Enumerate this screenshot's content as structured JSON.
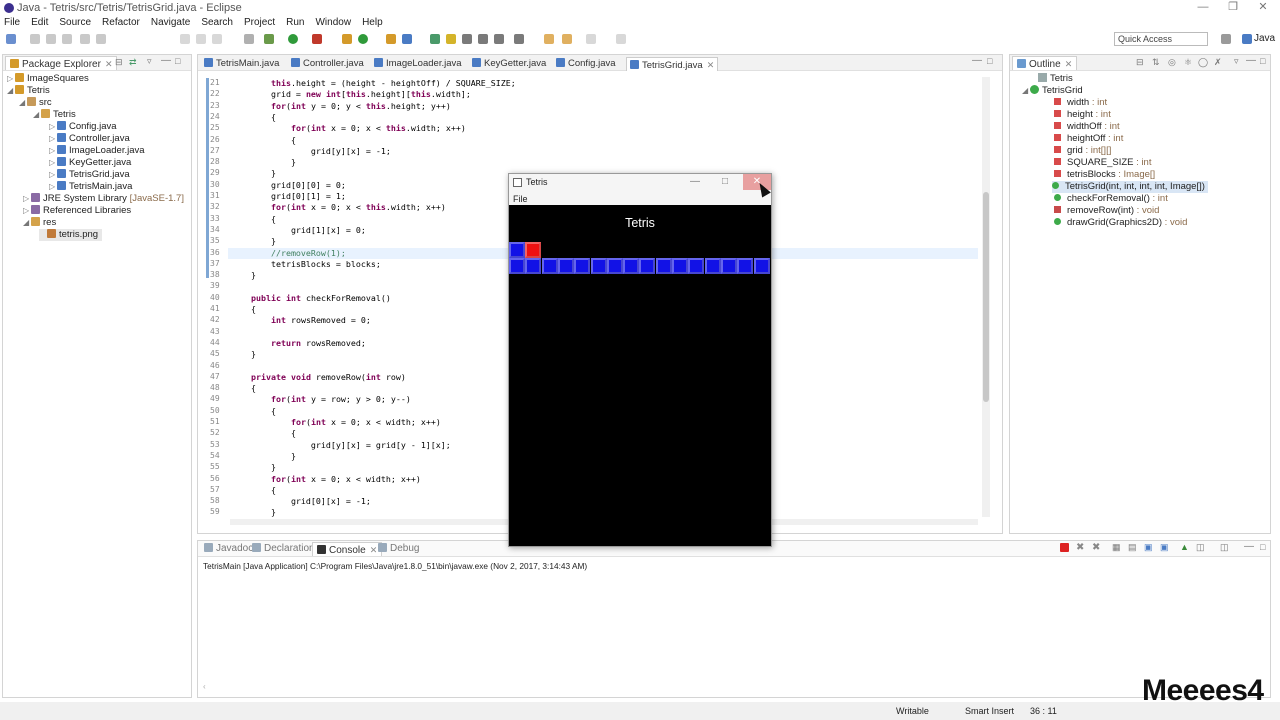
{
  "window": {
    "title": "Java - Tetris/src/Tetris/TetrisGrid.java - Eclipse"
  },
  "menubar": [
    "File",
    "Edit",
    "Source",
    "Refactor",
    "Navigate",
    "Search",
    "Project",
    "Run",
    "Window",
    "Help"
  ],
  "toolbar": {
    "quick_access": "Quick Access",
    "perspective": "Java"
  },
  "package_explorer": {
    "tab": "Package Explorer",
    "items": [
      {
        "label": "ImageSquares"
      },
      {
        "label": "Tetris"
      },
      {
        "label": "src"
      },
      {
        "label": "Tetris"
      },
      {
        "label": "Config.java"
      },
      {
        "label": "Controller.java"
      },
      {
        "label": "ImageLoader.java"
      },
      {
        "label": "KeyGetter.java"
      },
      {
        "label": "TetrisGrid.java"
      },
      {
        "label": "TetrisMain.java"
      },
      {
        "label": "JRE System Library",
        "decoration": "[JavaSE-1.7]"
      },
      {
        "label": "Referenced Libraries"
      },
      {
        "label": "res"
      },
      {
        "label": "tetris.png"
      }
    ]
  },
  "editor": {
    "tabs": [
      "TetrisMain.java",
      "Controller.java",
      "ImageLoader.java",
      "KeyGetter.java",
      "Config.java",
      "TetrisGrid.java"
    ],
    "active_tab": "TetrisGrid.java",
    "lines": [
      {
        "n": "21",
        "text": "        this.height = (height - heightOff) / SQUARE_SIZE;"
      },
      {
        "n": "22",
        "text": "        grid = new int[this.height][this.width];"
      },
      {
        "n": "23",
        "text": "        for(int y = 0; y < this.height; y++)"
      },
      {
        "n": "24",
        "text": "        {"
      },
      {
        "n": "25",
        "text": "            for(int x = 0; x < this.width; x++)"
      },
      {
        "n": "26",
        "text": "            {"
      },
      {
        "n": "27",
        "text": "                grid[y][x] = -1;"
      },
      {
        "n": "28",
        "text": "            }"
      },
      {
        "n": "29",
        "text": "        }"
      },
      {
        "n": "30",
        "text": "        grid[0][0] = 0;"
      },
      {
        "n": "31",
        "text": "        grid[0][1] = 1;"
      },
      {
        "n": "32",
        "text": "        for(int x = 0; x < this.width; x++)"
      },
      {
        "n": "33",
        "text": "        {"
      },
      {
        "n": "34",
        "text": "            grid[1][x] = 0;"
      },
      {
        "n": "35",
        "text": "        }"
      },
      {
        "n": "36",
        "text": "        //removeRow(1);"
      },
      {
        "n": "37",
        "text": "        tetrisBlocks = blocks;"
      },
      {
        "n": "38",
        "text": "    }"
      },
      {
        "n": "39",
        "text": ""
      },
      {
        "n": "40",
        "text": "    public int checkForRemoval()"
      },
      {
        "n": "41",
        "text": "    {"
      },
      {
        "n": "42",
        "text": "        int rowsRemoved = 0;"
      },
      {
        "n": "43",
        "text": ""
      },
      {
        "n": "44",
        "text": "        return rowsRemoved;"
      },
      {
        "n": "45",
        "text": "    }"
      },
      {
        "n": "46",
        "text": ""
      },
      {
        "n": "47",
        "text": "    private void removeRow(int row)"
      },
      {
        "n": "48",
        "text": "    {"
      },
      {
        "n": "49",
        "text": "        for(int y = row; y > 0; y--)"
      },
      {
        "n": "50",
        "text": "        {"
      },
      {
        "n": "51",
        "text": "            for(int x = 0; x < width; x++)"
      },
      {
        "n": "52",
        "text": "            {"
      },
      {
        "n": "53",
        "text": "                grid[y][x] = grid[y - 1][x];"
      },
      {
        "n": "54",
        "text": "            }"
      },
      {
        "n": "55",
        "text": "        }"
      },
      {
        "n": "56",
        "text": "        for(int x = 0; x < width; x++)"
      },
      {
        "n": "57",
        "text": "        {"
      },
      {
        "n": "58",
        "text": "            grid[0][x] = -1;"
      },
      {
        "n": "59",
        "text": "        }"
      }
    ]
  },
  "outline": {
    "tab": "Outline",
    "items": [
      {
        "name": "Tetris",
        "type": ""
      },
      {
        "name": "TetrisGrid",
        "type": ""
      },
      {
        "name": "width",
        "type": " : int"
      },
      {
        "name": "height",
        "type": " : int"
      },
      {
        "name": "widthOff",
        "type": " : int"
      },
      {
        "name": "heightOff",
        "type": " : int"
      },
      {
        "name": "grid",
        "type": " : int[][]"
      },
      {
        "name": "SQUARE_SIZE",
        "type": " : int"
      },
      {
        "name": "tetrisBlocks",
        "type": " : Image[]"
      },
      {
        "name": "TetrisGrid(int, int, int, int, Image[])",
        "type": ""
      },
      {
        "name": "checkForRemoval()",
        "type": " : int"
      },
      {
        "name": "removeRow(int)",
        "type": " : void"
      },
      {
        "name": "drawGrid(Graphics2D)",
        "type": " : void"
      }
    ]
  },
  "console": {
    "tabs": [
      "Javadoc",
      "Declaration",
      "Console",
      "Debug"
    ],
    "active_tab": "Console",
    "text": "TetrisMain [Java Application] C:\\Program Files\\Java\\jre1.8.0_51\\bin\\javaw.exe (Nov 2, 2017, 3:14:43 AM)"
  },
  "status": {
    "writable": "Writable",
    "insert_mode": "Smart Insert",
    "position": "36 : 11"
  },
  "tetris_window": {
    "title": "Tetris",
    "menu": "File",
    "heading": "Tetris",
    "colors": {
      "blue": "#1212e6",
      "red": "#ee1010"
    },
    "row0": [
      "blue",
      "red"
    ],
    "row1_count": 16
  },
  "watermark": "Meeees4"
}
